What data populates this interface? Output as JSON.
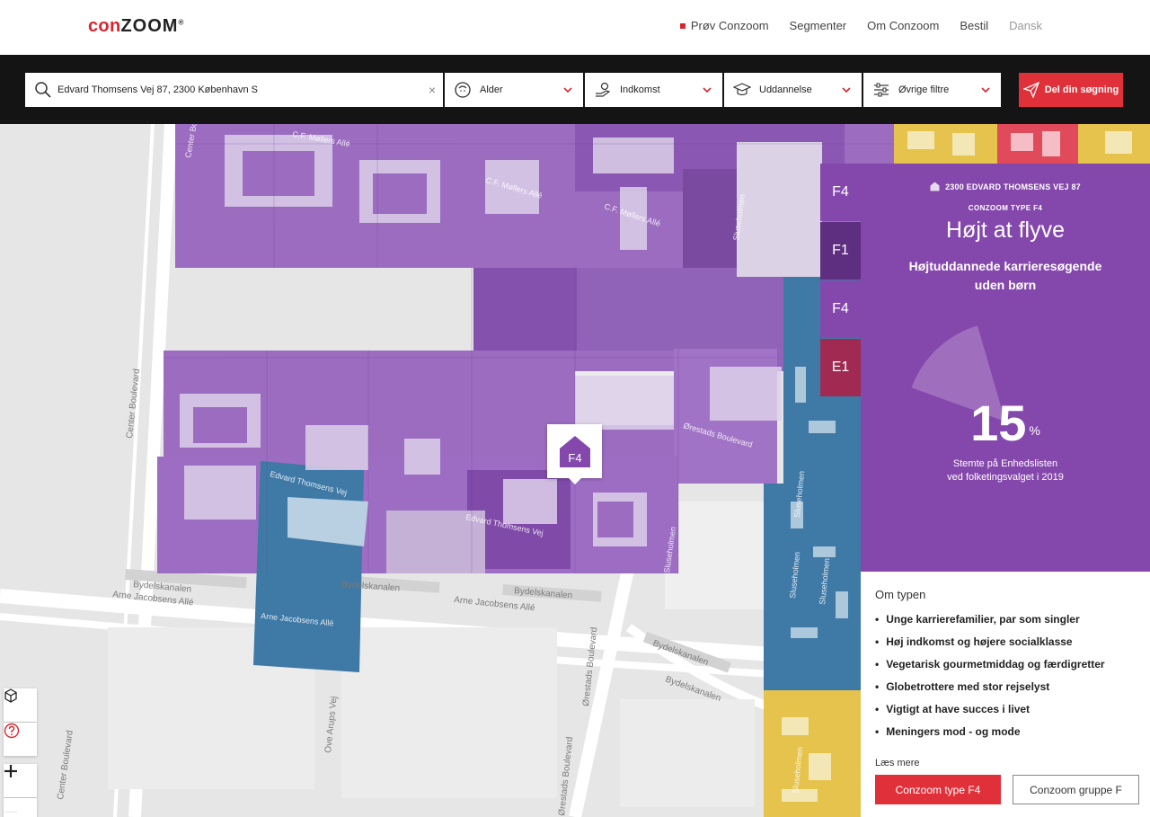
{
  "brand": {
    "logo_part1": "con",
    "logo_part2": "ZOOM",
    "logo_mark": "®"
  },
  "nav": {
    "items": [
      {
        "label": "Prøv Conzoom"
      },
      {
        "label": "Segmenter"
      },
      {
        "label": "Om Conzoom"
      },
      {
        "label": "Bestil"
      },
      {
        "label": "Dansk"
      }
    ]
  },
  "filters": {
    "search_value": "Edvard Thomsens Vej 87, 2300 København S",
    "clear_symbol": "×",
    "age_label": "Alder",
    "income_label": "Indkomst",
    "education_label": "Uddannelse",
    "other_label": "Øvrige filtre",
    "share_label": "Del din søgning"
  },
  "map": {
    "streets": [
      "C.F. Møllers Allé",
      "C.F. Møllers Allé",
      "C.F. Møllers Allé",
      "Center Boulevard",
      "Center Boulevard",
      "Center Boulevard",
      "Edvard Thomsens Vej",
      "Edvard Thomsens Vej",
      "Ørestads Boulevard",
      "Ørestads Boulevard",
      "Ørestads Boulevard",
      "Arne Jacobsens Allé",
      "Arne Jacobsens Allé",
      "Arne Jacobsens Allé",
      "Bydelskanalen",
      "Bydelskanalen",
      "Bydelskanalen",
      "Bydelskanalen",
      "Bydelskanalen",
      "Ove Arups Vej",
      "Sluseholmen",
      "Sluseholmen",
      "Sluseholmen",
      "Sluseholmen",
      "Sluseholmen",
      "Sluseholmen"
    ],
    "marker_label": "F4",
    "colors": {
      "purple": "#8447ac",
      "blue": "#3f79a6",
      "yellow": "#e5c34c",
      "red": "#c7384b"
    }
  },
  "segments": [
    {
      "label": "F4",
      "color": "#8447ac"
    },
    {
      "label": "F1",
      "color": "#5e2e80"
    },
    {
      "label": "F4",
      "color": "#8447ac"
    },
    {
      "label": "E1",
      "color": "#a02a52"
    }
  ],
  "panel": {
    "address": "2300 EDVARD THOMSENS VEJ 87",
    "type_label": "CONZOOM TYPE F4",
    "type_title": "Højt at flyve",
    "type_subtitle": "Højtuddannede karrieresøgende uden børn",
    "stat_percent": 15,
    "stat_value": "15",
    "stat_unit": "%",
    "stat_caption": "Stemte på Enhedslisten ved folketingsvalget i 2019",
    "about_title": "Om typen",
    "traits": [
      "Unge karrierefamilier, par som singler",
      "Høj indkomst og højere socialklasse",
      "Vegetarisk gourmetmiddag og færdigretter",
      "Globetrottere med stor rejselyst",
      "Vigtigt at have succes i livet",
      "Meningers mod - og mode"
    ],
    "read_more": "Læs mere",
    "btn_type": "Conzoom type F4",
    "btn_group": "Conzoom gruppe F"
  }
}
